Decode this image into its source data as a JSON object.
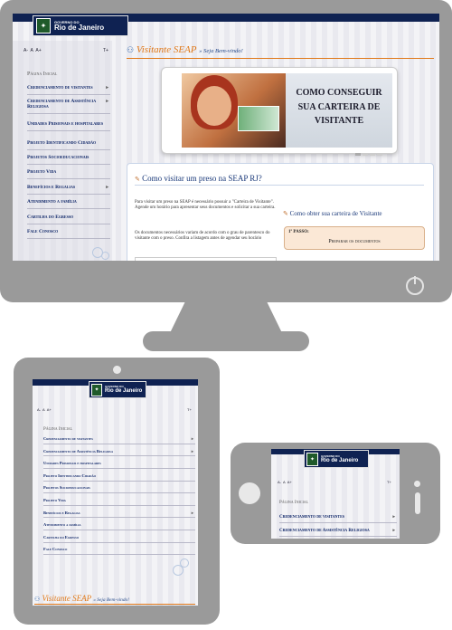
{
  "logo": {
    "line1": "GOVERNO DO",
    "line2": "Rio de Janeiro"
  },
  "font_controls": {
    "a_small": "A-",
    "a_normal": "A",
    "a_large": "A+",
    "side": "T+"
  },
  "menu": {
    "home": "Página Inicial",
    "items": [
      {
        "label": "Credenciamento de visitantes",
        "arrow": "▸"
      },
      {
        "label": "Credenciamento de Assistência Religiosa",
        "arrow": "▸"
      },
      {
        "label": "Unidades Prisionais e hospitalares",
        "arrow": ""
      },
      {
        "label": "Projeto Identificando Cidadão",
        "arrow": ""
      },
      {
        "label": "Projetos Socioeducacionais",
        "arrow": ""
      },
      {
        "label": "Projeto Vida",
        "arrow": ""
      },
      {
        "label": "Benefícios e Regalias",
        "arrow": "▸"
      },
      {
        "label": "Atendimento a família",
        "arrow": ""
      },
      {
        "label": "Cartilha do Egresso",
        "arrow": ""
      },
      {
        "label": "Fale Conosco",
        "arrow": ""
      }
    ]
  },
  "header": {
    "title": "Visitante SEAP",
    "subtitle": "» Seja Bem-vindo!"
  },
  "banner": {
    "text": "COMO CONSEGUIR SUA CARTEIRA DE VISITANTE"
  },
  "main": {
    "heading": "Como visitar um preso na SEAP RJ?",
    "para1": "Para visitar um preso na SEAP é necessário possuir a \"Carteira de Visitante\". Agende um horário para apresentar seus documentos e solicitar a sua carteira.",
    "para2": "Os documentos necessários variam de acordo com o grau de parentesco do visitante com o preso. Confira a listagem antes de agendar seu horário"
  },
  "side_box": {
    "heading": "Como obter sua carteira de Visitante",
    "step_label": "1º PASSO:",
    "step_value": "Preparar os documentos"
  },
  "colors": {
    "navy": "#0f2252",
    "orange": "#e07818",
    "frame": "#9a9a9a"
  }
}
